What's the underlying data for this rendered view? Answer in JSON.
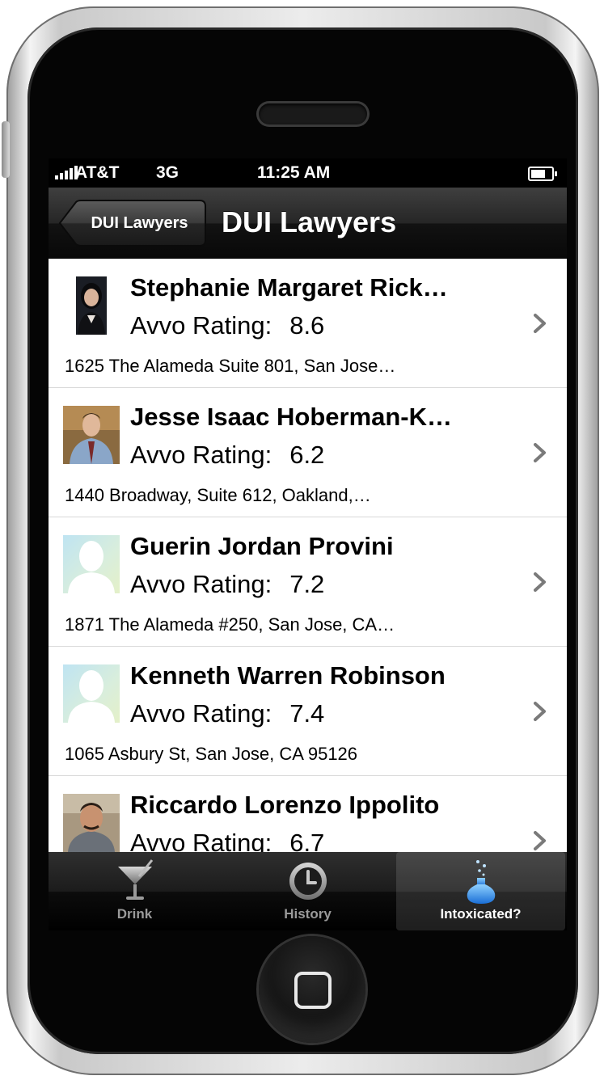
{
  "status_bar": {
    "carrier": "AT&T",
    "network": "3G",
    "time": "11:25 AM"
  },
  "nav_bar": {
    "back_label": "DUI Lawyers",
    "title": "DUI Lawyers"
  },
  "rating_label": "Avvo Rating:",
  "lawyers": [
    {
      "name": "Stephanie Margaret Rick…",
      "rating": "8.6",
      "address": "1625 The Alameda Suite 801, San Jose…"
    },
    {
      "name": "Jesse Isaac Hoberman-K…",
      "rating": "6.2",
      "address": "1440 Broadway, Suite 612, Oakland,…"
    },
    {
      "name": "Guerin Jordan Provini",
      "rating": "7.2",
      "address": "1871 The Alameda #250, San Jose, CA…"
    },
    {
      "name": "Kenneth Warren Robinson",
      "rating": "7.4",
      "address": "1065 Asbury St, San Jose, CA 95126"
    },
    {
      "name": "Riccardo Lorenzo Ippolito",
      "rating": "6.7",
      "address": ""
    }
  ],
  "tabs": [
    {
      "label": "Drink",
      "icon": "martini-icon",
      "active": false
    },
    {
      "label": "History",
      "icon": "clock-icon",
      "active": false
    },
    {
      "label": "Intoxicated?",
      "icon": "bubbling-flask-icon",
      "active": true
    }
  ],
  "colors": {
    "nav_dark": "#1b1b1b",
    "active_tab_text": "#ffffff",
    "inactive_tab_text": "#9a9a9a",
    "flask_blue": "#3fa0ff"
  }
}
